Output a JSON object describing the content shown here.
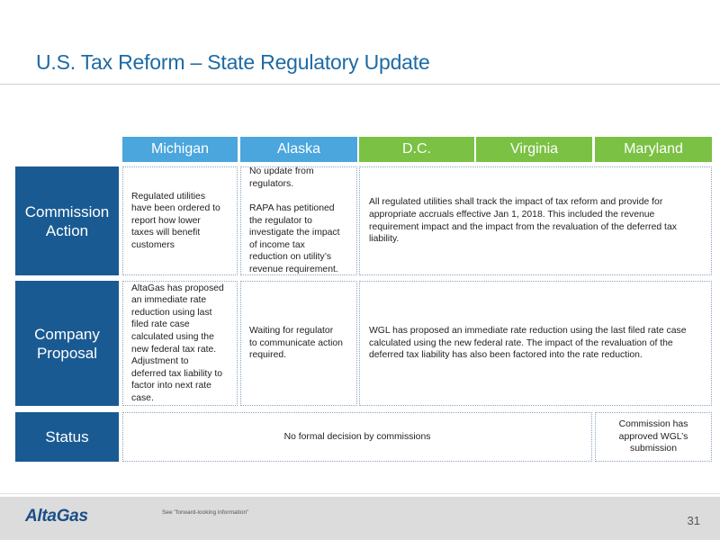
{
  "slide": {
    "title": "U.S. Tax Reform – State Regulatory Update"
  },
  "columns": [
    "Michigan",
    "Alaska",
    "D.C.",
    "Virginia",
    "Maryland"
  ],
  "rows": {
    "commission": {
      "label": "Commission\nAction",
      "michigan": "Regulated utilities\nhave been ordered to\nreport how lower\ntaxes will benefit\ncustomers",
      "alaska": "No update from\nregulators.\n\nRAPA has petitioned\nthe regulator to\ninvestigate the impact\nof income tax\nreduction on utility’s\nrevenue requirement.",
      "dc_va_md": "All regulated utilities shall track the impact of tax reform and provide for appropriate accruals  effective Jan 1, 2018. This included the revenue requirement impact and the impact from the revaluation of the deferred tax liability."
    },
    "proposal": {
      "label": "Company\nProposal",
      "michigan": "AltaGas has proposed\nan immediate rate\nreduction using last\nfiled rate case\ncalculated using the\nnew federal tax rate.\nAdjustment to\ndeferred tax liability to\nfactor into next rate\ncase.",
      "alaska": "Waiting for regulator\nto communicate action\nrequired.",
      "dc_va_md": "WGL has proposed an immediate rate reduction using the last filed rate case calculated using the new federal rate.  The impact of the revaluation of the deferred tax liability has also been factored into the rate reduction."
    },
    "status": {
      "label": "Status",
      "main": "No formal decision by commissions",
      "maryland": "Commission has\napproved WGL’s\nsubmission"
    }
  },
  "colors": {
    "title": "#1d6aa5",
    "header_blue": "#4aa6dd",
    "header_green": "#7bc144",
    "row_header": "#1a5a93"
  },
  "footer": {
    "logo": "AltaGas",
    "disclaimer": "See \"forward-looking information\"",
    "page_number": "31"
  }
}
